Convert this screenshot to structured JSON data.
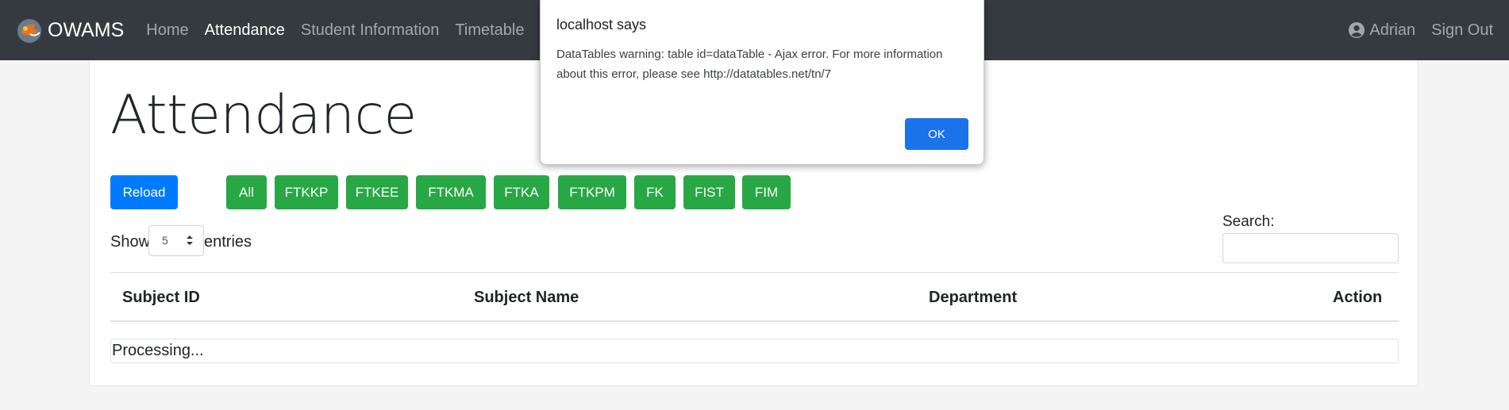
{
  "navbar": {
    "brand": "OWAMS",
    "links": [
      "Home",
      "Attendance",
      "Student Information",
      "Timetable"
    ],
    "user": "Adrian",
    "signout": "Sign Out"
  },
  "page": {
    "title": "Attendance",
    "reload_label": "Reload",
    "filters": [
      "All",
      "FTKKP",
      "FTKEE",
      "FTKMA",
      "FTKA",
      "FTKPM",
      "FK",
      "FIST",
      "FIM"
    ],
    "show_label": "Show",
    "entries_value": "5",
    "entries_label": "entries",
    "search_label": "Search:",
    "search_value": "",
    "columns": [
      "Subject ID",
      "Subject Name",
      "Department",
      "Action"
    ],
    "processing": "Processing..."
  },
  "dialog": {
    "title": "localhost says",
    "message": "DataTables warning: table id=dataTable - Ajax error. For more information about this error, please see http://datatables.net/tn/7",
    "ok": "OK"
  },
  "colors": {
    "navbar": "#343a40",
    "primary": "#007bff",
    "success": "#28a745",
    "dialog_button": "#1a73e8"
  }
}
